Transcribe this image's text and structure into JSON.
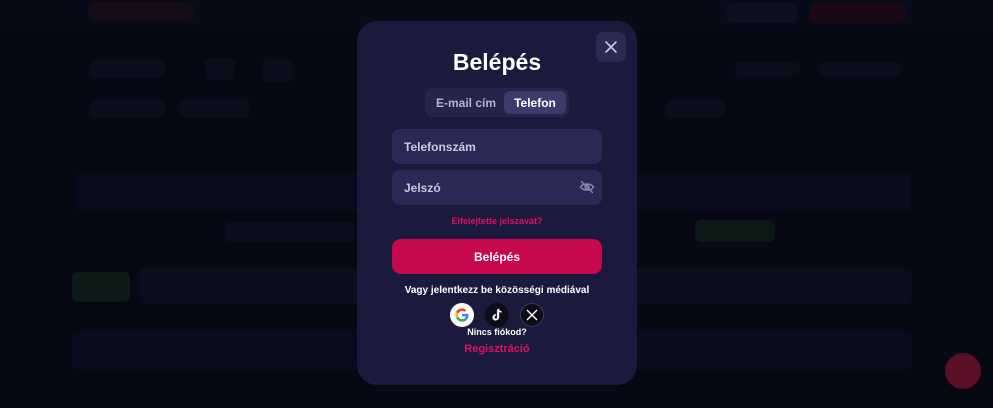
{
  "modal": {
    "title": "Belépés",
    "tabs": [
      {
        "label": "E-mail cím",
        "active": false
      },
      {
        "label": "Telefon",
        "active": true
      }
    ],
    "phone_placeholder": "Telefonszám",
    "password_placeholder": "Jelszó",
    "forgot_password": "Elfelejtette jelszavát?",
    "login_button": "Belépés",
    "social_prompt": "Vagy jelentkezz be közösségi médiával",
    "social_icons": [
      "google-icon",
      "tiktok-icon",
      "x-icon"
    ],
    "no_account": "Nincs fiókod?",
    "register_link": "Regisztráció"
  },
  "colors": {
    "accent": "#e0115f",
    "button": "#c8084e",
    "modal_bg": "#1b1a3d",
    "field_bg": "#2a2955"
  }
}
